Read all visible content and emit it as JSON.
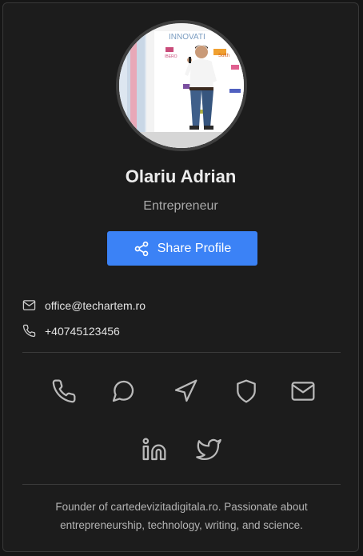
{
  "profile": {
    "name": "Olariu Adrian",
    "title": "Entrepreneur",
    "share_label": "Share Profile",
    "bio": "Founder of cartedevizitadigitala.ro. Passionate about entrepreneurship, technology, writing, and science."
  },
  "contact": {
    "email": "office@techartem.ro",
    "phone": "+40745123456"
  },
  "photo_text": {
    "banner": "INNOVATI",
    "badge": "IBERO",
    "rightSign": "Softh"
  },
  "socials": [
    "phone-icon",
    "message-circle-icon",
    "send-icon",
    "shield-icon",
    "mail-icon",
    "linkedin-icon",
    "twitter-icon"
  ],
  "colors": {
    "accent": "#3b82f6",
    "card_bg": "#1c1c1c",
    "icon": "#b9b9b9"
  }
}
